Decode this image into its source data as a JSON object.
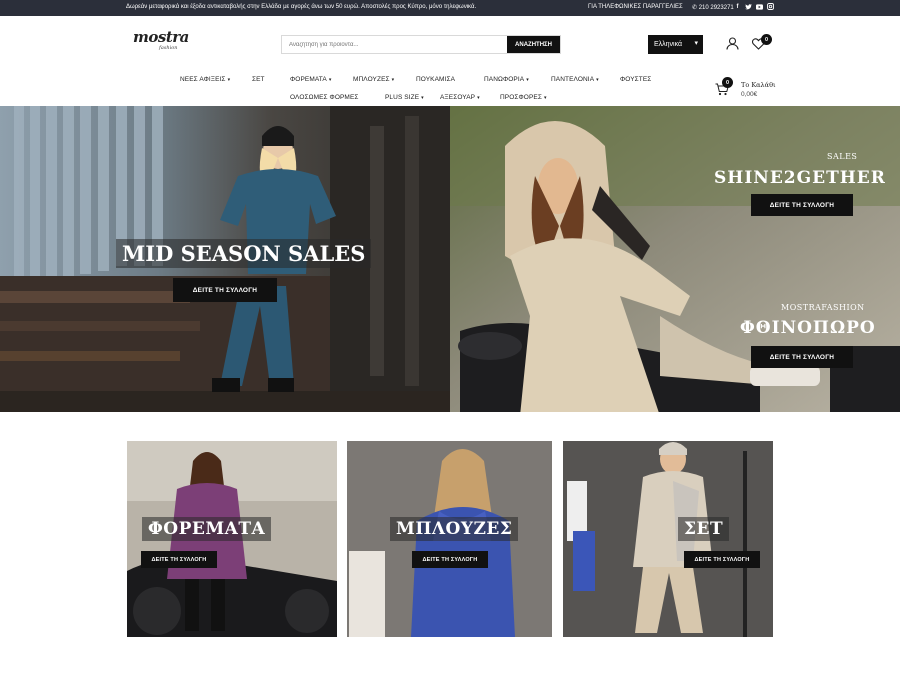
{
  "topbar": {
    "message": "Δωρεάν μεταφορικά και έξοδα αντικαταβολής στην Ελλάδα με αγορές άνω των 50 ευρώ. Αποστολές προς Κύπρο, μόνο τηλεφωνικά.",
    "phone_note": "ΓΙΑ ΤΗΛΕΦΩΝΙΚΕΣ ΠΑΡΑΓΓΕΛΙΕΣ",
    "phone": "210 2923271",
    "socials": [
      "facebook-icon",
      "twitter-icon",
      "youtube-icon",
      "instagram-icon"
    ]
  },
  "header": {
    "logo_word": "mostra",
    "logo_sub": "fashion",
    "search_placeholder": "Αναζήτηση για προϊόντα...",
    "search_button": "ΑΝΑΖΗΤΗΣΗ",
    "language": "Ελληνικά",
    "wishlist_count": "0",
    "cart_count": "0",
    "cart_label": "Το Καλάθι",
    "cart_total": "0,00€"
  },
  "nav": {
    "new_arrivals": "ΝΕΕΣ ΑΦΙΞΕΙΣ",
    "set": "ΣΕΤ",
    "dresses": "ΦΟΡΕΜΑΤΑ",
    "blouses": "ΜΠΛΟΥΖΕΣ",
    "shirts": "ΠΟΥΚΑΜΙΣΑ",
    "jackets": "ΠΑΝΩΦΟΡΙΑ",
    "trousers": "ΠΑΝΤΕΛΟΝΙΑ",
    "skirts": "ΦΟΥΣΤΕΣ",
    "jumpsuits": "ΟΛΟΣΩΜΕΣ ΦΟΡΜΕΣ",
    "plus_size": "PLUS SIZE",
    "accessories": "ΑΞΕΣΟΥΑΡ",
    "offers": "ΠΡΟΣΦΟΡΕΣ"
  },
  "hero": {
    "left_title": "MID SEASON SALES",
    "left_cta": "ΔΕΙΤΕ ΤΗ ΣΥΛΛΟΓΗ",
    "right_top_sub": "SALES",
    "right_top_title": "SHINE2GETHER",
    "right_top_cta": "ΔΕΙΤΕ ΤΗ ΣΥΛΛΟΓΗ",
    "right_bottom_sub": "MOSTRAFASHION",
    "right_bottom_title": "ΦΘΙΝΟΠΩΡΟ",
    "right_bottom_cta": "ΔΕΙΤΕ ΤΗ ΣΥΛΛΟΓΗ"
  },
  "categories": [
    {
      "title": "ΦΟΡΕΜΑΤΑ",
      "cta": "ΔΕΙΤΕ ΤΗ ΣΥΛΛΟΓΗ"
    },
    {
      "title": "ΜΠΛΟΥΖΕΣ",
      "cta": "ΔΕΙΤΕ ΤΗ ΣΥΛΛΟΓΗ"
    },
    {
      "title": "ΣΕΤ",
      "cta": "ΔΕΙΤΕ ΤΗ ΣΥΛΛΟΓΗ"
    }
  ],
  "colors": {
    "topbar": "#2b2f3a",
    "button": "#111111",
    "text": "#222222"
  }
}
